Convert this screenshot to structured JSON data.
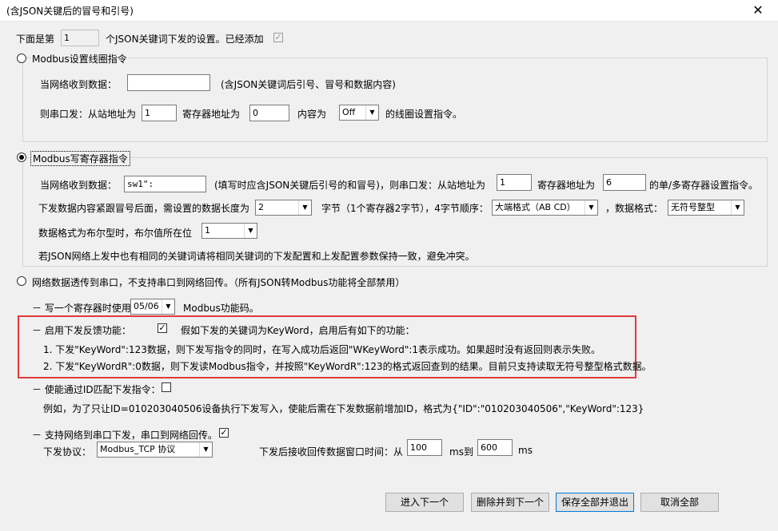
{
  "window": {
    "title": "(含JSON关键后的冒号和引号)",
    "close_icon": "✕"
  },
  "header": {
    "prefix": "下面是第",
    "index_value": "1",
    "suffix": "个JSON关键词下发的设置。已经添加",
    "added_checked": true
  },
  "coil": {
    "label": "Modbus设置线圈指令",
    "recv_label": "当网络收到数据：",
    "recv_value": "",
    "recv_hint": "(含JSON关键词后引号、冒号和数据内容)",
    "send_label": "则串口发：从站地址为",
    "slave_value": "1",
    "reg_label": "寄存器地址为",
    "reg_value": "0",
    "content_label": "内容为",
    "content_value": "Off",
    "tail": "的线圈设置指令。"
  },
  "write_reg": {
    "label": "Modbus写寄存器指令",
    "recv_label": "当网络收到数据：",
    "recv_value": "sw1\":",
    "recv_hint": "(填写时应含JSON关键后引号的和冒号)，则串口发：从站地址为",
    "slave_value": "1",
    "reg_label": "寄存器地址为",
    "reg_value": "6",
    "reg_tail": "的单/多寄存器设置指令。",
    "len_label": "下发数据内容紧跟冒号后面，需设置的数据长度为",
    "len_value": "2",
    "byte_label": "字节（1个寄存器2字节），4字节顺序：",
    "order_value": "大端格式（AB CD）",
    "fmt_label": "，数据格式：",
    "fmt_value": "无符号整型",
    "bool_label": "数据格式为布尔型时，布尔值所在位",
    "bool_value": "1",
    "note": "若JSON网络上发中也有相同的关键词请将相同关键词的下发配置和上发配置参数保持一致，避免冲突。"
  },
  "transparent": {
    "label": "网络数据透传到串口，不支持串口到网络回传。（所有JSON转Modbus功能将全部禁用）"
  },
  "func_code": {
    "label": "－ 写一个寄存器时使用",
    "value": "05/06",
    "tail": "Modbus功能码。"
  },
  "feedback": {
    "label": "－ 启用下发反馈功能：",
    "checked": true,
    "desc": "假如下发的关键词为KeyWord，启用后有如下的功能：",
    "line1": "1. 下发\"KeyWord\":123数据，则下发写指令的同时，在写入成功后返回\"WKeyWord\":1表示成功。如果超时没有返回则表示失败。",
    "line2": "2. 下发\"KeyWordR\":0数据，则下发读Modbus指令，并按照\"KeyWordR\":123的格式返回查到的结果。目前只支持读取无符号整型格式数据。"
  },
  "id_match": {
    "label": "－ 使能通过ID匹配下发指令：",
    "checked": false,
    "example": "例如，为了只让ID=010203040506设备执行下发写入，使能后需在下发数据前增加ID，格式为{\"ID\":\"010203040506\",\"KeyWord\":123}"
  },
  "net_serial": {
    "label": "－ 支持网络到串口下发，串口到网络回传。",
    "checked": true,
    "protocol_label": "下发协议：",
    "protocol_value": "Modbus_TCP 协议",
    "window_label": "下发后接收回传数据窗口时间：从",
    "from_value": "100",
    "ms_to": "ms到",
    "to_value": "600",
    "ms": "ms"
  },
  "buttons": {
    "next": "进入下一个",
    "delete_next": "删除并到下一个",
    "save_exit": "保存全部并退出",
    "cancel": "取消全部"
  },
  "checkmark": "✓",
  "dropdown_icon": "▼"
}
